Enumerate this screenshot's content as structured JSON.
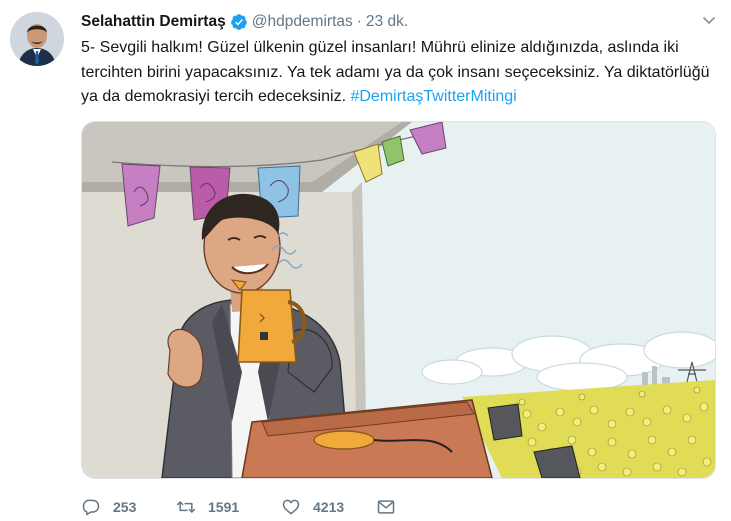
{
  "tweet": {
    "display_name": "Selahattin Demirtaş",
    "handle": "@hdpdemirtas",
    "separator": "·",
    "time": "23 dk.",
    "text": "5- Sevgili halkım! Güzel ülkenin güzel insanları! Mührü elinize aldığınızda, aslında iki tercihten birini yapacaksınız. Ya tek adamı ya da çok insanı seçeceksiniz. Ya diktatörlüğü ya da demokrasiyi tercih edeceksiniz.",
    "hashtag": "#DemirtaşTwitterMitingi"
  },
  "actions": {
    "reply_count": "253",
    "retweet_count": "1591",
    "like_count": "4213"
  },
  "icons": {
    "verified": "verified-badge-icon",
    "menu": "chevron-down-icon",
    "reply": "reply-icon",
    "retweet": "retweet-icon",
    "like": "heart-icon",
    "dm": "envelope-icon"
  },
  "colors": {
    "accent": "#1da1f2",
    "muted": "#657786",
    "text": "#14171a"
  }
}
